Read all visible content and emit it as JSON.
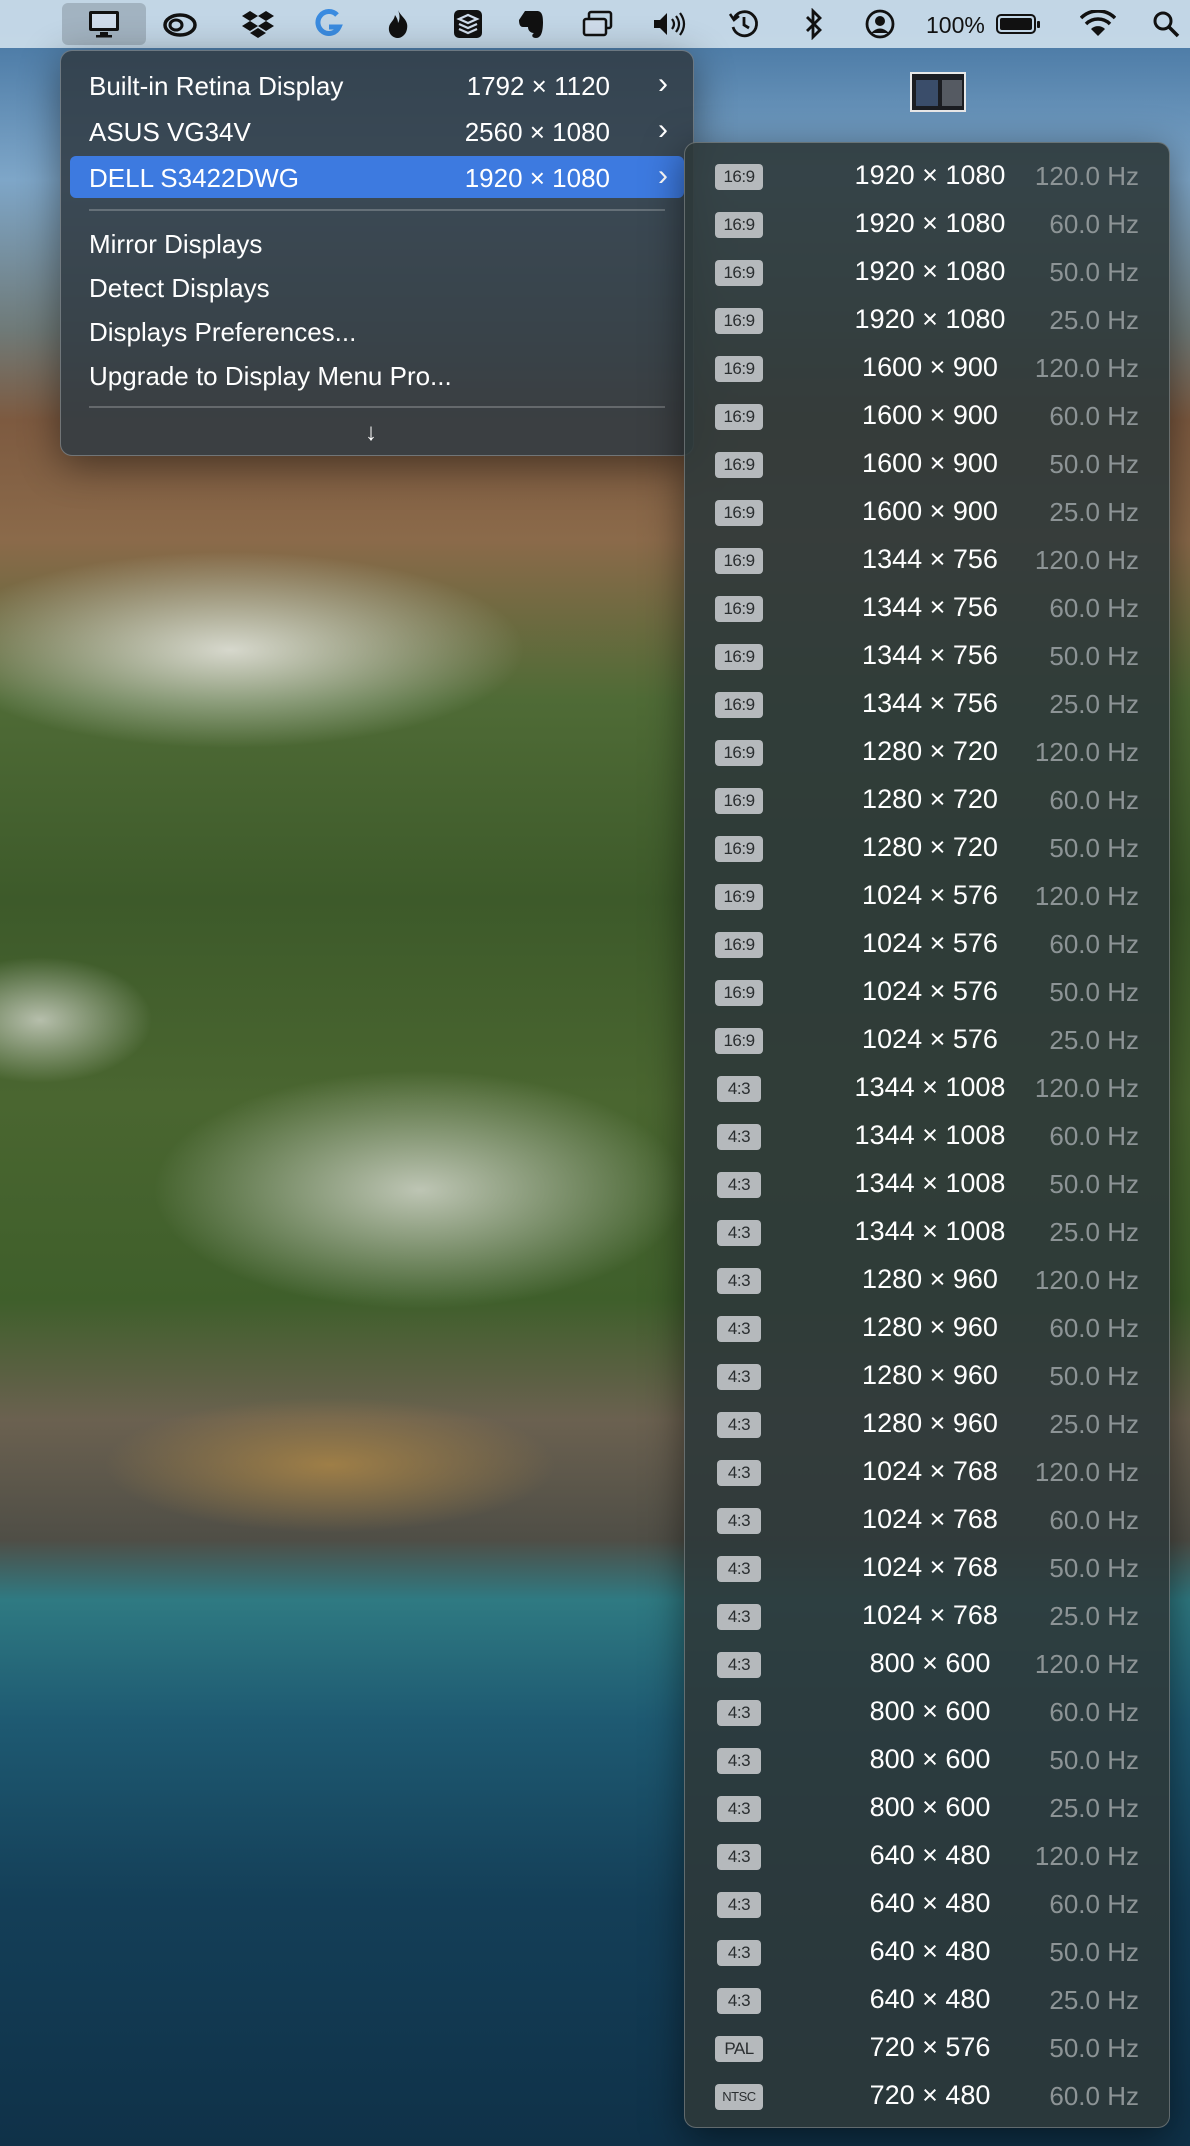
{
  "menubar": {
    "battery_percent": "100%",
    "battery_level": 1.0,
    "icons": [
      "display-icon",
      "creative-cloud-icon",
      "dropbox-icon",
      "logi-icon",
      "flame-icon",
      "layers-icon",
      "evernote-icon",
      "window-icon",
      "volume-icon",
      "time-machine-icon",
      "bluetooth-icon",
      "user-icon",
      "battery-icon",
      "wifi-icon",
      "search-icon"
    ]
  },
  "menu": {
    "displays": [
      {
        "name": "Built-in Retina Display",
        "resolution": "1792 × 1120",
        "chevron": "›"
      },
      {
        "name": "ASUS VG34V",
        "resolution": "2560 × 1080",
        "chevron": "›"
      },
      {
        "name": "DELL S3422DWG",
        "resolution": "1920 × 1080",
        "chevron": "›",
        "selected": true
      }
    ],
    "actions": [
      "Mirror Displays",
      "Detect Displays",
      "Displays Preferences...",
      "Upgrade to Display Menu Pro..."
    ],
    "more_arrow": "↓"
  },
  "submenu": {
    "modes": [
      {
        "aspect": "16:9",
        "resolution": "1920 × 1080",
        "refresh": "120.0 Hz"
      },
      {
        "aspect": "16:9",
        "resolution": "1920 × 1080",
        "refresh": "60.0 Hz"
      },
      {
        "aspect": "16:9",
        "resolution": "1920 × 1080",
        "refresh": "50.0 Hz"
      },
      {
        "aspect": "16:9",
        "resolution": "1920 × 1080",
        "refresh": "25.0 Hz"
      },
      {
        "aspect": "16:9",
        "resolution": "1600 × 900",
        "refresh": "120.0 Hz"
      },
      {
        "aspect": "16:9",
        "resolution": "1600 × 900",
        "refresh": "60.0 Hz"
      },
      {
        "aspect": "16:9",
        "resolution": "1600 × 900",
        "refresh": "50.0 Hz"
      },
      {
        "aspect": "16:9",
        "resolution": "1600 × 900",
        "refresh": "25.0 Hz"
      },
      {
        "aspect": "16:9",
        "resolution": "1344 × 756",
        "refresh": "120.0 Hz"
      },
      {
        "aspect": "16:9",
        "resolution": "1344 × 756",
        "refresh": "60.0 Hz"
      },
      {
        "aspect": "16:9",
        "resolution": "1344 × 756",
        "refresh": "50.0 Hz"
      },
      {
        "aspect": "16:9",
        "resolution": "1344 × 756",
        "refresh": "25.0 Hz"
      },
      {
        "aspect": "16:9",
        "resolution": "1280 × 720",
        "refresh": "120.0 Hz"
      },
      {
        "aspect": "16:9",
        "resolution": "1280 × 720",
        "refresh": "60.0 Hz"
      },
      {
        "aspect": "16:9",
        "resolution": "1280 × 720",
        "refresh": "50.0 Hz"
      },
      {
        "aspect": "16:9",
        "resolution": "1024 × 576",
        "refresh": "120.0 Hz"
      },
      {
        "aspect": "16:9",
        "resolution": "1024 × 576",
        "refresh": "60.0 Hz"
      },
      {
        "aspect": "16:9",
        "resolution": "1024 × 576",
        "refresh": "50.0 Hz"
      },
      {
        "aspect": "16:9",
        "resolution": "1024 × 576",
        "refresh": "25.0 Hz"
      },
      {
        "aspect": "4:3",
        "resolution": "1344 × 1008",
        "refresh": "120.0 Hz"
      },
      {
        "aspect": "4:3",
        "resolution": "1344 × 1008",
        "refresh": "60.0 Hz"
      },
      {
        "aspect": "4:3",
        "resolution": "1344 × 1008",
        "refresh": "50.0 Hz"
      },
      {
        "aspect": "4:3",
        "resolution": "1344 × 1008",
        "refresh": "25.0 Hz"
      },
      {
        "aspect": "4:3",
        "resolution": "1280 × 960",
        "refresh": "120.0 Hz"
      },
      {
        "aspect": "4:3",
        "resolution": "1280 × 960",
        "refresh": "60.0 Hz"
      },
      {
        "aspect": "4:3",
        "resolution": "1280 × 960",
        "refresh": "50.0 Hz"
      },
      {
        "aspect": "4:3",
        "resolution": "1280 × 960",
        "refresh": "25.0 Hz"
      },
      {
        "aspect": "4:3",
        "resolution": "1024 × 768",
        "refresh": "120.0 Hz"
      },
      {
        "aspect": "4:3",
        "resolution": "1024 × 768",
        "refresh": "60.0 Hz"
      },
      {
        "aspect": "4:3",
        "resolution": "1024 × 768",
        "refresh": "50.0 Hz"
      },
      {
        "aspect": "4:3",
        "resolution": "1024 × 768",
        "refresh": "25.0 Hz"
      },
      {
        "aspect": "4:3",
        "resolution": "800 × 600",
        "refresh": "120.0 Hz"
      },
      {
        "aspect": "4:3",
        "resolution": "800 × 600",
        "refresh": "60.0 Hz"
      },
      {
        "aspect": "4:3",
        "resolution": "800 × 600",
        "refresh": "50.0 Hz"
      },
      {
        "aspect": "4:3",
        "resolution": "800 × 600",
        "refresh": "25.0 Hz"
      },
      {
        "aspect": "4:3",
        "resolution": "640 × 480",
        "refresh": "120.0 Hz"
      },
      {
        "aspect": "4:3",
        "resolution": "640 × 480",
        "refresh": "60.0 Hz"
      },
      {
        "aspect": "4:3",
        "resolution": "640 × 480",
        "refresh": "50.0 Hz"
      },
      {
        "aspect": "4:3",
        "resolution": "640 × 480",
        "refresh": "25.0 Hz"
      },
      {
        "aspect": "PAL",
        "resolution": "720 × 576",
        "refresh": "50.0 Hz"
      },
      {
        "aspect": "NTSC",
        "resolution": "720 × 480",
        "refresh": "60.0 Hz"
      }
    ]
  },
  "colors": {
    "selection": "#3d7ae0",
    "refresh_text": "#8d9496",
    "badge": "#b5b9bc"
  }
}
